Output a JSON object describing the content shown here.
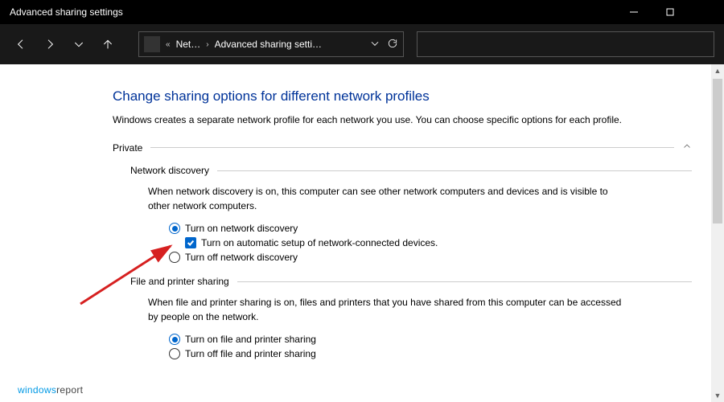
{
  "titlebar": {
    "title": "Advanced sharing settings"
  },
  "breadcrumb": {
    "seg1": "Net…",
    "seg2": "Advanced sharing setti…"
  },
  "page": {
    "heading": "Change sharing options for different network profiles",
    "sub": "Windows creates a separate network profile for each network you use. You can choose specific options for each profile."
  },
  "sections": {
    "private": {
      "label": "Private",
      "network_discovery": {
        "label": "Network discovery",
        "desc": "When network discovery is on, this computer can see other network computers and devices and is visible to other network computers.",
        "opt_on": "Turn on network discovery",
        "opt_auto": "Turn on automatic setup of network-connected devices.",
        "opt_off": "Turn off network discovery"
      },
      "file_printer": {
        "label": "File and printer sharing",
        "desc": "When file and printer sharing is on, files and printers that you have shared from this computer can be accessed by people on the network.",
        "opt_on": "Turn on file and printer sharing",
        "opt_off": "Turn off file and printer sharing"
      }
    }
  },
  "watermark": {
    "w1": "windows",
    "w2": "report"
  }
}
